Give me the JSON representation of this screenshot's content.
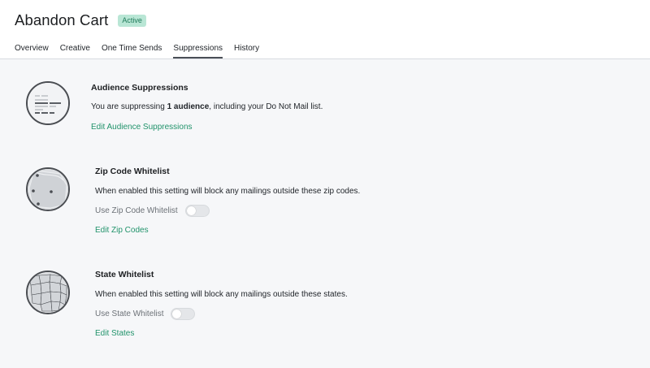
{
  "header": {
    "title": "Abandon Cart",
    "status_badge": "Active"
  },
  "tabs": [
    {
      "label": "Overview",
      "active": false
    },
    {
      "label": "Creative",
      "active": false
    },
    {
      "label": "One Time Sends",
      "active": false
    },
    {
      "label": "Suppressions",
      "active": true
    },
    {
      "label": "History",
      "active": false
    }
  ],
  "audience": {
    "icon": "audience-list-icon",
    "title": "Audience Suppressions",
    "text_before": "You are suppressing ",
    "text_bold": "1 audience",
    "text_after": ", including your Do Not Mail list.",
    "link": "Edit Audience Suppressions"
  },
  "zip": {
    "icon": "zip-map-icon",
    "title": "Zip Code Whitelist",
    "description": "When enabled this setting will block any mailings outside these zip codes.",
    "toggle_label": "Use Zip Code Whitelist",
    "toggle_on": false,
    "link": "Edit Zip Codes"
  },
  "state": {
    "icon": "state-map-icon",
    "title": "State Whitelist",
    "description": "When enabled this setting will block any mailings outside these states.",
    "toggle_label": "Use State Whitelist",
    "toggle_on": false,
    "link": "Edit States"
  },
  "colors": {
    "accent_link": "#21936b",
    "badge_bg": "#b9e6d5",
    "badge_text": "#1f7a5a",
    "content_bg": "#f6f7f9"
  }
}
